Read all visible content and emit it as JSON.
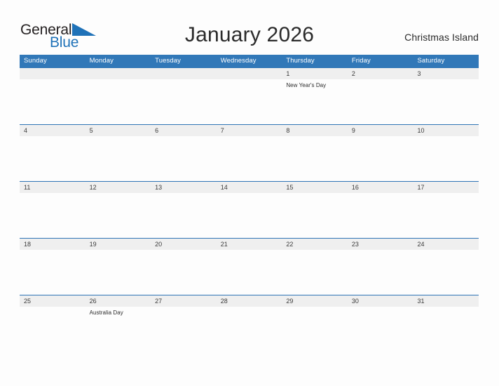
{
  "brand": {
    "name_part1": "General",
    "name_part2": "Blue",
    "flag_icon": "blue-triangle-flag-icon",
    "accent_color": "#1f72b8"
  },
  "header": {
    "title": "January 2026",
    "location": "Christmas Island"
  },
  "theme": {
    "header_bar_color": "#3178b8",
    "row_divider_color": "#2e74b5",
    "day_band_color": "#efefef",
    "page_background": "#fdfdfd"
  },
  "calendar": {
    "weekdays": [
      "Sunday",
      "Monday",
      "Tuesday",
      "Wednesday",
      "Thursday",
      "Friday",
      "Saturday"
    ],
    "weeks": [
      {
        "days": [
          {
            "date": "",
            "event": ""
          },
          {
            "date": "",
            "event": ""
          },
          {
            "date": "",
            "event": ""
          },
          {
            "date": "",
            "event": ""
          },
          {
            "date": "1",
            "event": "New Year's Day"
          },
          {
            "date": "2",
            "event": ""
          },
          {
            "date": "3",
            "event": ""
          }
        ]
      },
      {
        "days": [
          {
            "date": "4",
            "event": ""
          },
          {
            "date": "5",
            "event": ""
          },
          {
            "date": "6",
            "event": ""
          },
          {
            "date": "7",
            "event": ""
          },
          {
            "date": "8",
            "event": ""
          },
          {
            "date": "9",
            "event": ""
          },
          {
            "date": "10",
            "event": ""
          }
        ]
      },
      {
        "days": [
          {
            "date": "11",
            "event": ""
          },
          {
            "date": "12",
            "event": ""
          },
          {
            "date": "13",
            "event": ""
          },
          {
            "date": "14",
            "event": ""
          },
          {
            "date": "15",
            "event": ""
          },
          {
            "date": "16",
            "event": ""
          },
          {
            "date": "17",
            "event": ""
          }
        ]
      },
      {
        "days": [
          {
            "date": "18",
            "event": ""
          },
          {
            "date": "19",
            "event": ""
          },
          {
            "date": "20",
            "event": ""
          },
          {
            "date": "21",
            "event": ""
          },
          {
            "date": "22",
            "event": ""
          },
          {
            "date": "23",
            "event": ""
          },
          {
            "date": "24",
            "event": ""
          }
        ]
      },
      {
        "days": [
          {
            "date": "25",
            "event": ""
          },
          {
            "date": "26",
            "event": "Australia Day"
          },
          {
            "date": "27",
            "event": ""
          },
          {
            "date": "28",
            "event": ""
          },
          {
            "date": "29",
            "event": ""
          },
          {
            "date": "30",
            "event": ""
          },
          {
            "date": "31",
            "event": ""
          }
        ]
      }
    ]
  }
}
